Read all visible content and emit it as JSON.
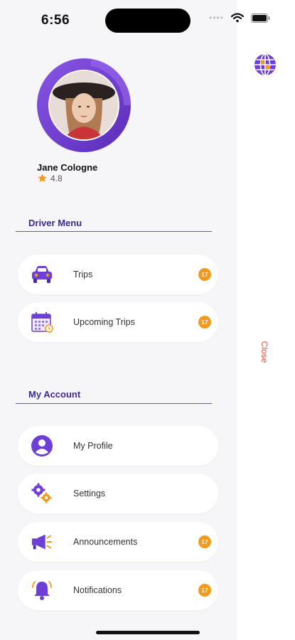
{
  "status_bar": {
    "time": "6:56"
  },
  "profile": {
    "name": "Jane Cologne",
    "rating": "4.8"
  },
  "driver_menu": {
    "title": "Driver Menu",
    "items": [
      {
        "label": "Trips",
        "icon": "car-icon",
        "badge": "17"
      },
      {
        "label": "Upcoming Trips",
        "icon": "calendar-icon",
        "badge": "17"
      }
    ]
  },
  "my_account": {
    "title": "My Account",
    "items": [
      {
        "label": "My Profile",
        "icon": "user-icon"
      },
      {
        "label": "Settings",
        "icon": "gears-icon"
      },
      {
        "label": "Announcements",
        "icon": "megaphone-icon",
        "badge": "17"
      },
      {
        "label": "Notifications",
        "icon": "bell-icon",
        "badge": "17"
      }
    ]
  },
  "close_label": "Close",
  "colors": {
    "accent": "#6d3fd6",
    "badge": "#f29a1f",
    "close": "#e4533a",
    "section_title": "#3d2a8c"
  }
}
